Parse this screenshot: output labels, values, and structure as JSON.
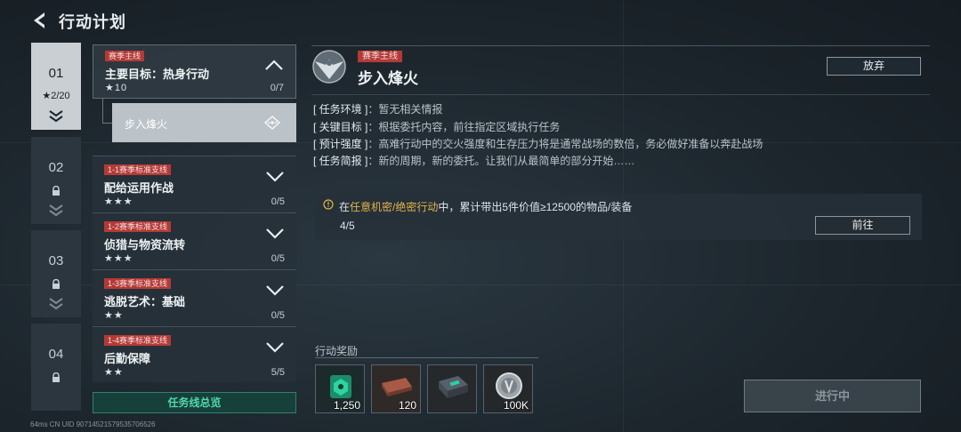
{
  "header": {
    "title": "行动计划"
  },
  "chapters": [
    {
      "num": "01",
      "stars": "★2/20",
      "active": true
    },
    {
      "num": "02"
    },
    {
      "num": "03"
    },
    {
      "num": "04"
    }
  ],
  "missions": {
    "main": {
      "tag": "赛季主线",
      "title": "主要目标：热身行动",
      "stars": "★10",
      "progress": "0/7"
    },
    "subtask": {
      "label": "步入烽火"
    },
    "list": [
      {
        "tag": "1-1赛季标准支线",
        "title": "配给运用作战",
        "stars": "★★★",
        "progress": "0/5"
      },
      {
        "tag": "1-2赛季标准支线",
        "title": "侦猎与物资流转",
        "stars": "★★★",
        "progress": "0/5"
      },
      {
        "tag": "1-3赛季标准支线",
        "title": "逃脱艺术：基础",
        "stars": "★★",
        "progress": "0/5"
      },
      {
        "tag": "1-4赛季标准支线",
        "title": "后勤保障",
        "stars": "★★",
        "progress": "5/5"
      }
    ],
    "overview_label": "任务线总览"
  },
  "detail": {
    "season_tag": "赛季主线",
    "name": "步入烽火",
    "abandon_label": "放弃",
    "info": [
      {
        "key": "[ 任务环境 ]",
        "value": "：暂无相关情报"
      },
      {
        "key": "[ 关键目标 ]",
        "value": "：根据委托内容，前往指定区域执行任务"
      },
      {
        "key": "[ 预计强度 ]",
        "value": "：高难行动中的交火强度和生存压力将是通常战场的数倍，务必做好准备以奔赴战场"
      },
      {
        "key": "[ 任务简报 ]",
        "value": "：新的周期，新的委托。让我们从最简单的部分开始……"
      }
    ],
    "objective": {
      "prefix": "在",
      "highlight": "任意机密/绝密行动",
      "suffix": "中，累计带出5件价值≥12500的物品/装备",
      "count": "4/5"
    },
    "goto_label": "前往",
    "rewards_label": "行动奖励",
    "rewards": [
      {
        "icon": "green-token-icon",
        "count": "1,250"
      },
      {
        "icon": "ammo-box-icon",
        "count": "120"
      },
      {
        "icon": "supply-case-icon",
        "count": ""
      },
      {
        "icon": "silver-coin-icon",
        "count": "100K"
      }
    ],
    "in_progress_label": "进行中"
  },
  "status": {
    "text": "64ms   CN UID 9071452157953570652​6"
  },
  "colors": {
    "tag_red": "#b43a36",
    "highlight": "#e3b44a",
    "overview_green": "#4ed8ad"
  }
}
